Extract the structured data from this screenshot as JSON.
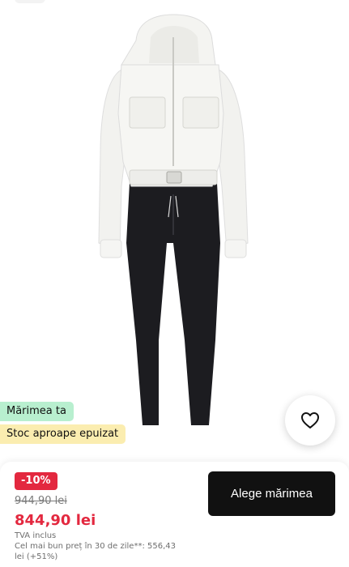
{
  "badges": {
    "size": "Mărimea ta",
    "stock": "Stoc aproape epuizat"
  },
  "icons": {
    "wishlist": "heart-outline-icon"
  },
  "price": {
    "discount": "-10%",
    "old": "944,90 lei",
    "current": "844,90 lei",
    "vat": "TVA inclus",
    "best_price": "Cel mai bun preț în 30 de zile**: 556,43 lei (+51%)"
  },
  "actions": {
    "choose_size": "Alege mărimea"
  },
  "colors": {
    "size_badge": "#b8efcf",
    "stock_badge": "#fbedb0",
    "price_red": "#e3283f",
    "button_dark": "#111111"
  }
}
